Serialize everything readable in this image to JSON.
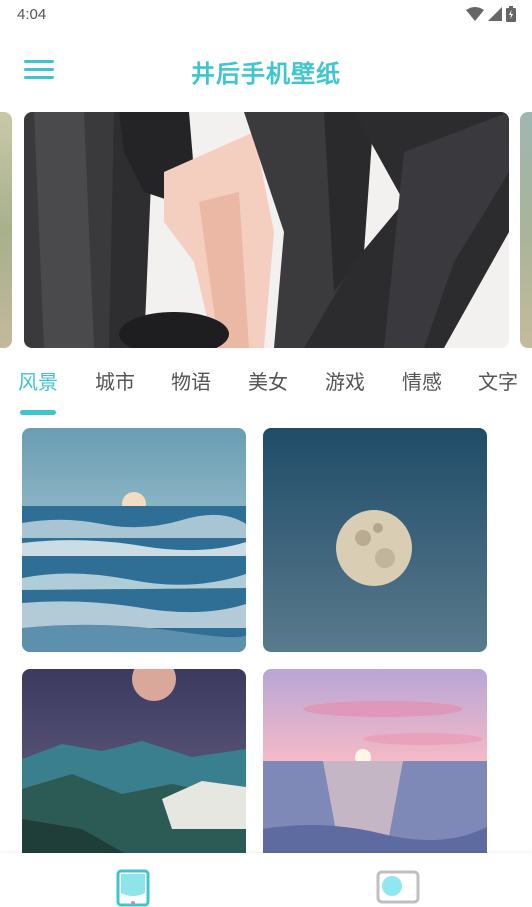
{
  "status_bar": {
    "time": "4:04",
    "icons": [
      "wifi-icon",
      "signal-icon",
      "battery-icon"
    ]
  },
  "header": {
    "title": "井后手机壁纸",
    "menu_icon": "menu-icon"
  },
  "tabs": [
    {
      "label": "风景",
      "active": true
    },
    {
      "label": "城市",
      "active": false
    },
    {
      "label": "物语",
      "active": false
    },
    {
      "label": "美女",
      "active": false
    },
    {
      "label": "游戏",
      "active": false
    },
    {
      "label": "情感",
      "active": false
    },
    {
      "label": "文字",
      "active": false
    }
  ],
  "bottom_nav": {
    "items": [
      "phone-wallpaper-icon",
      "desktop-wallpaper-icon"
    ]
  },
  "colors": {
    "accent": "#3ec6cf",
    "tab_inactive": "#555555"
  }
}
